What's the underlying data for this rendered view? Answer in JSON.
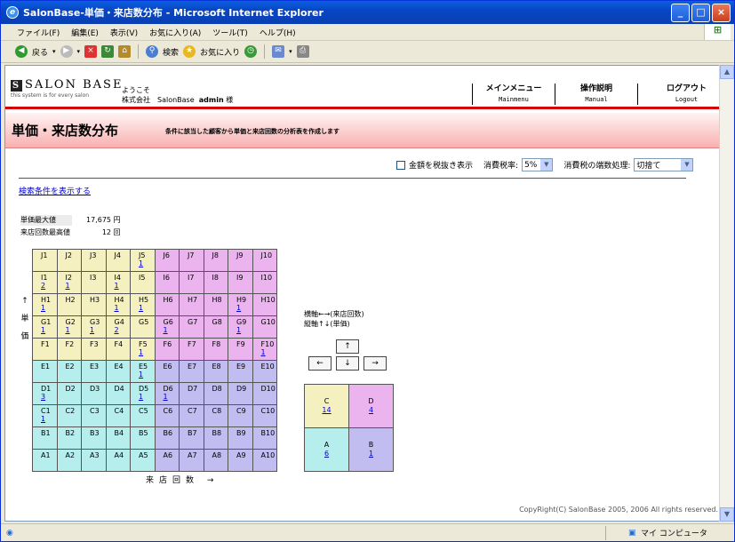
{
  "window": {
    "title": "SalonBase-単価・来店数分布 - Microsoft Internet Explorer",
    "min": "_",
    "max": "□",
    "close": "×"
  },
  "menu": [
    "ファイル(F)",
    "編集(E)",
    "表示(V)",
    "お気に入り(A)",
    "ツール(T)",
    "ヘルプ(H)"
  ],
  "toolbar": {
    "back": "戻る",
    "search": "検索",
    "favorites": "お気に入り"
  },
  "header": {
    "logo": "SALON BASE",
    "tagline": "this system is for every salon",
    "welcome": "ようこそ",
    "company": "株式会社　SalonBase",
    "user": "admin",
    "honorific": "様",
    "nav": [
      {
        "jp": "メインメニュー",
        "en": "Mainmenu"
      },
      {
        "jp": "操作説明",
        "en": "Manual"
      },
      {
        "jp": "ログアウト",
        "en": "Logout"
      }
    ]
  },
  "page": {
    "title": "単価・来店数分布",
    "desc": "条件に該当した顧客から単価と来店回数の分析表を作成します"
  },
  "options": {
    "tax_excl": "金額を税抜き表示",
    "tax_rate_label": "消費税率:",
    "tax_rate": "5%",
    "rounding_label": "消費税の端数処理:",
    "rounding": "切捨て"
  },
  "search_link": "検索条件を表示する",
  "stats": {
    "max_price_label": "単価最大値",
    "max_price": "17,675 円",
    "max_visit_label": "来店回数最高値",
    "max_visit": "12 回"
  },
  "grid": [
    [
      {
        "l": "J1"
      },
      {
        "l": "J2"
      },
      {
        "l": "J3"
      },
      {
        "l": "J4"
      },
      {
        "l": "J5",
        "n": "1"
      },
      {
        "l": "J6"
      },
      {
        "l": "J7"
      },
      {
        "l": "J8"
      },
      {
        "l": "J9"
      },
      {
        "l": "J10"
      }
    ],
    [
      {
        "l": "I1",
        "n": "2"
      },
      {
        "l": "I2",
        "n": "1"
      },
      {
        "l": "I3"
      },
      {
        "l": "I4",
        "n": "1"
      },
      {
        "l": "I5"
      },
      {
        "l": "I6"
      },
      {
        "l": "I7"
      },
      {
        "l": "I8"
      },
      {
        "l": "I9"
      },
      {
        "l": "I10"
      }
    ],
    [
      {
        "l": "H1",
        "n": "1"
      },
      {
        "l": "H2"
      },
      {
        "l": "H3"
      },
      {
        "l": "H4",
        "n": "1"
      },
      {
        "l": "H5",
        "n": "1"
      },
      {
        "l": "H6"
      },
      {
        "l": "H7"
      },
      {
        "l": "H8"
      },
      {
        "l": "H9",
        "n": "1"
      },
      {
        "l": "H10"
      }
    ],
    [
      {
        "l": "G1",
        "n": "1"
      },
      {
        "l": "G2",
        "n": "1"
      },
      {
        "l": "G3",
        "n": "1"
      },
      {
        "l": "G4",
        "n": "2"
      },
      {
        "l": "G5"
      },
      {
        "l": "G6",
        "n": "1"
      },
      {
        "l": "G7"
      },
      {
        "l": "G8"
      },
      {
        "l": "G9",
        "n": "1"
      },
      {
        "l": "G10"
      }
    ],
    [
      {
        "l": "F1"
      },
      {
        "l": "F2"
      },
      {
        "l": "F3"
      },
      {
        "l": "F4"
      },
      {
        "l": "F5",
        "n": "1"
      },
      {
        "l": "F6"
      },
      {
        "l": "F7"
      },
      {
        "l": "F8"
      },
      {
        "l": "F9"
      },
      {
        "l": "F10",
        "n": "1"
      }
    ],
    [
      {
        "l": "E1"
      },
      {
        "l": "E2"
      },
      {
        "l": "E3"
      },
      {
        "l": "E4"
      },
      {
        "l": "E5",
        "n": "1"
      },
      {
        "l": "E6"
      },
      {
        "l": "E7"
      },
      {
        "l": "E8"
      },
      {
        "l": "E9"
      },
      {
        "l": "E10"
      }
    ],
    [
      {
        "l": "D1",
        "n": "3"
      },
      {
        "l": "D2"
      },
      {
        "l": "D3"
      },
      {
        "l": "D4"
      },
      {
        "l": "D5",
        "n": "1"
      },
      {
        "l": "D6",
        "n": "1"
      },
      {
        "l": "D7"
      },
      {
        "l": "D8"
      },
      {
        "l": "D9"
      },
      {
        "l": "D10"
      }
    ],
    [
      {
        "l": "C1",
        "n": "1"
      },
      {
        "l": "C2"
      },
      {
        "l": "C3"
      },
      {
        "l": "C4"
      },
      {
        "l": "C5"
      },
      {
        "l": "C6"
      },
      {
        "l": "C7"
      },
      {
        "l": "C8"
      },
      {
        "l": "C9"
      },
      {
        "l": "C10"
      }
    ],
    [
      {
        "l": "B1"
      },
      {
        "l": "B2"
      },
      {
        "l": "B3"
      },
      {
        "l": "B4"
      },
      {
        "l": "B5"
      },
      {
        "l": "B6"
      },
      {
        "l": "B7"
      },
      {
        "l": "B8"
      },
      {
        "l": "B9"
      },
      {
        "l": "B10"
      }
    ],
    [
      {
        "l": "A1"
      },
      {
        "l": "A2"
      },
      {
        "l": "A3"
      },
      {
        "l": "A4"
      },
      {
        "l": "A5"
      },
      {
        "l": "A6"
      },
      {
        "l": "A7"
      },
      {
        "l": "A8"
      },
      {
        "l": "A9"
      },
      {
        "l": "A10"
      }
    ]
  ],
  "y_axis_label": [
    "↑",
    "単",
    "価"
  ],
  "x_axis_label": "来店回数 →",
  "axis_note": [
    "横軸←→(来店回数)",
    "縦軸↑↓(単価)"
  ],
  "arrows": {
    "up": "↑",
    "down": "↓",
    "left": "←",
    "right": "→"
  },
  "quadrants": {
    "C": {
      "l": "C",
      "n": "14"
    },
    "D": {
      "l": "D",
      "n": "4"
    },
    "A": {
      "l": "A",
      "n": "6"
    },
    "B": {
      "l": "B",
      "n": "1"
    }
  },
  "colors": {
    "C": "#f4f0c0",
    "D": "#ebb4ef",
    "A": "#b6eded",
    "B": "#c2bdf0",
    "header_red": "#d20000"
  },
  "copyright": "CopyRight(C) SalonBase 2005, 2006 All rights reserved.",
  "status": {
    "zone": "マイ コンピュータ"
  }
}
